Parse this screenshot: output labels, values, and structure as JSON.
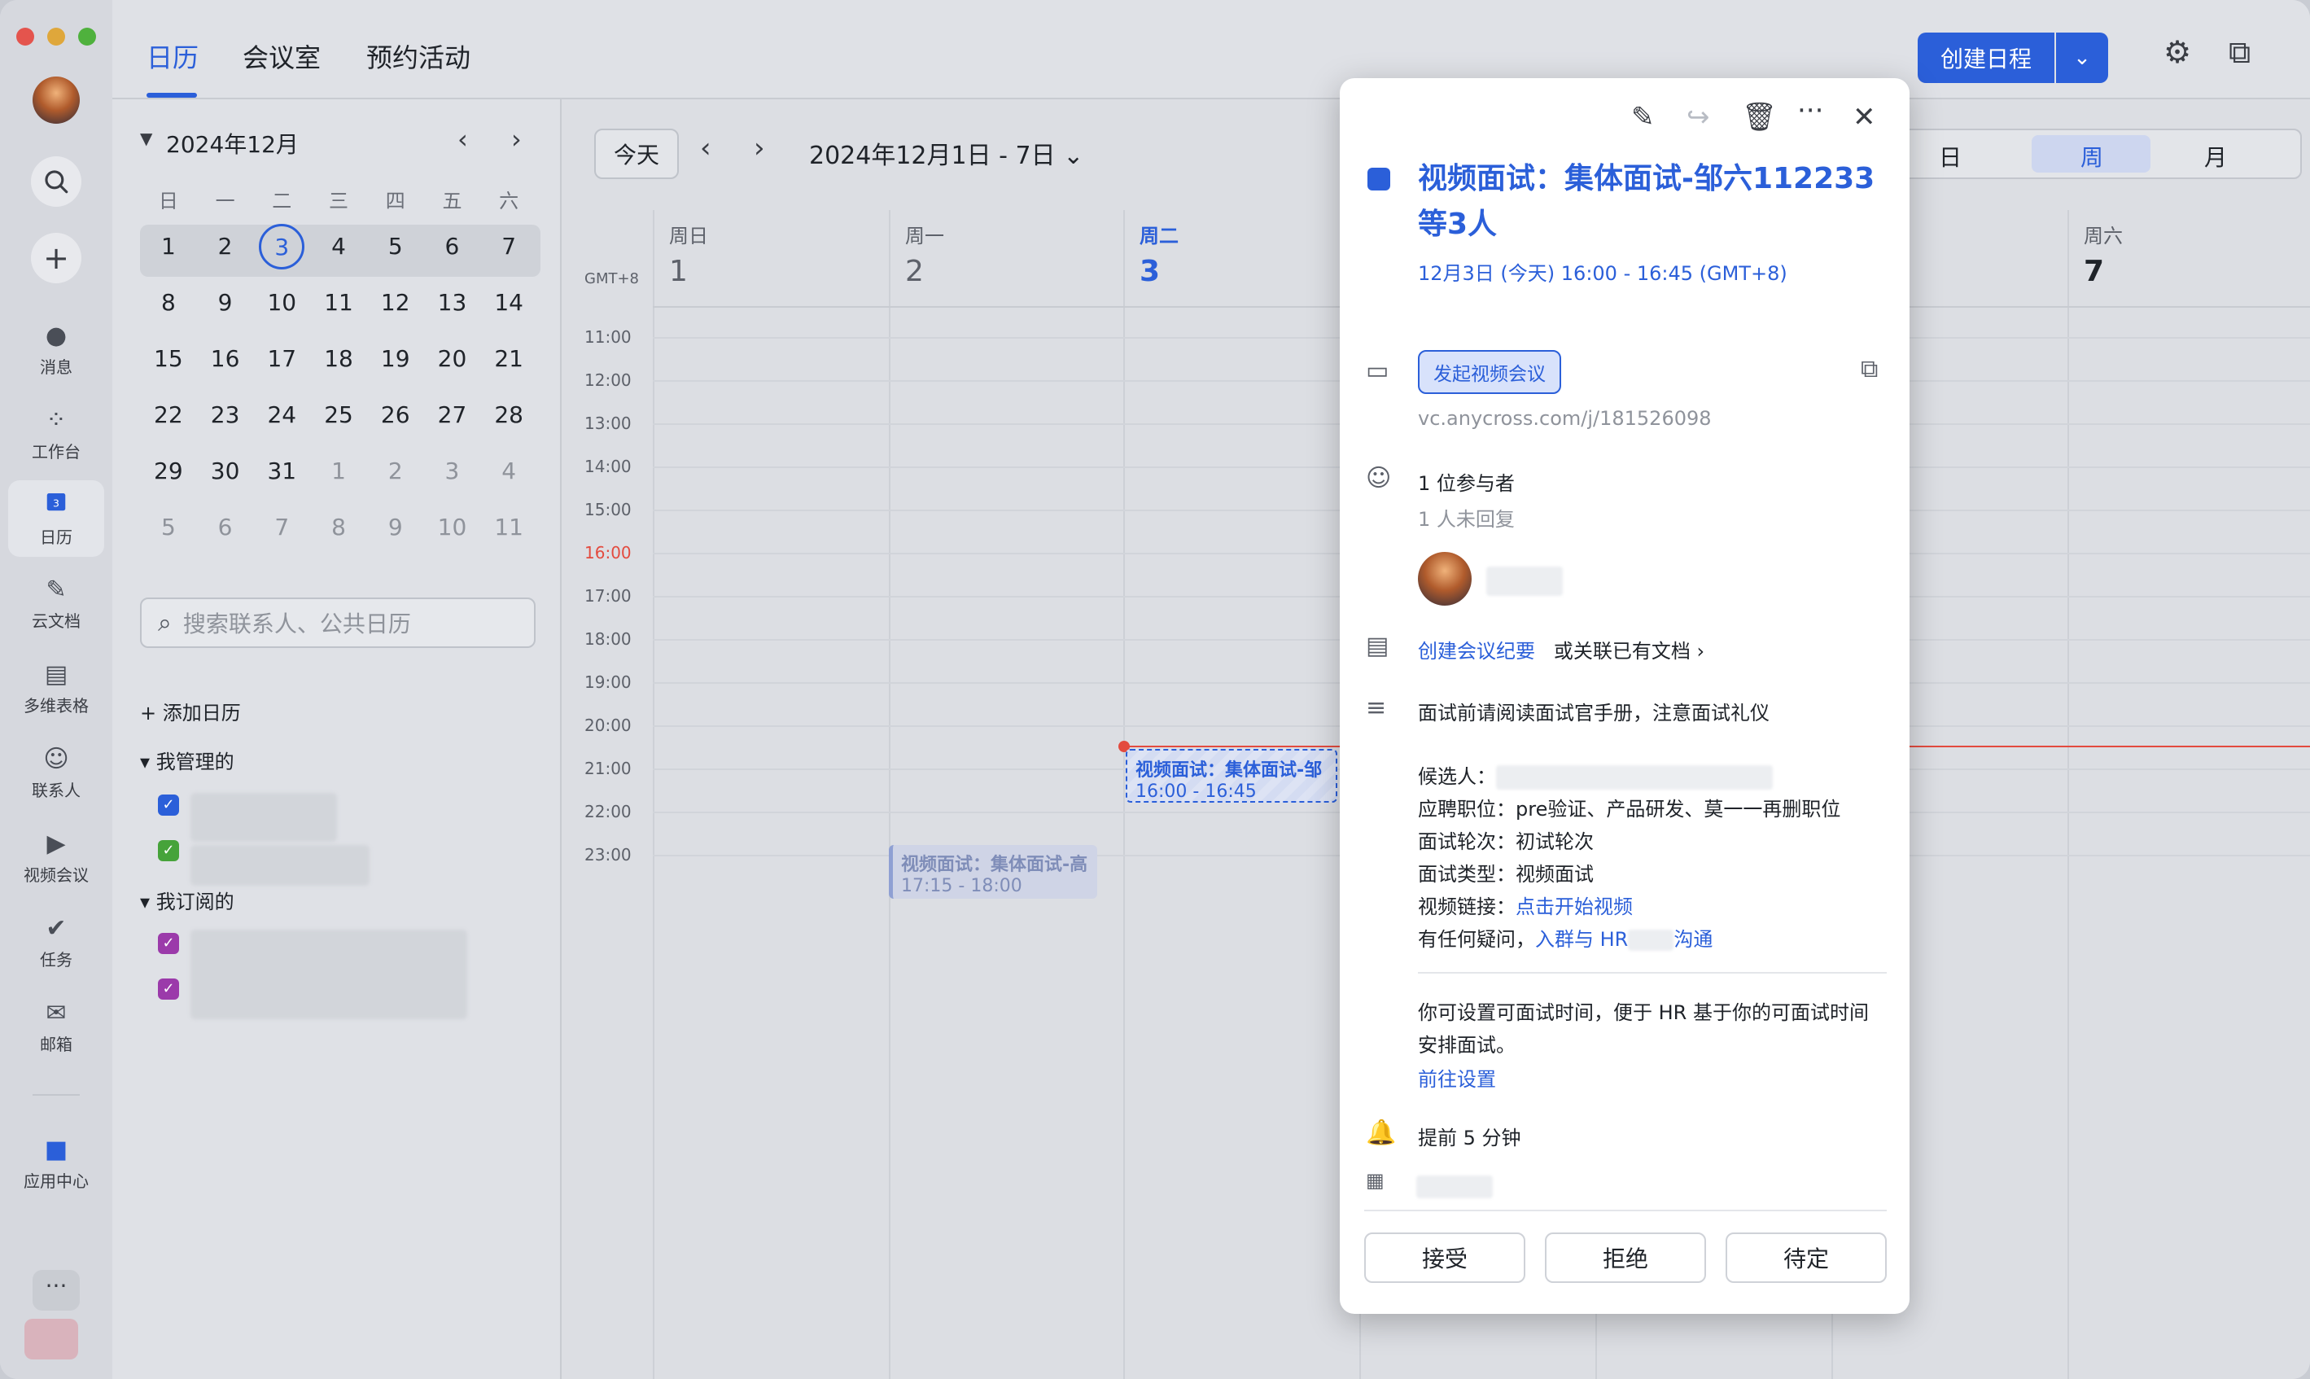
{
  "rail": {
    "items": [
      {
        "label": "消息",
        "icon": "chat-bubble-icon"
      },
      {
        "label": "工作台",
        "icon": "grid-icon"
      },
      {
        "label": "日历",
        "icon": "calendar-icon",
        "badge": "3"
      },
      {
        "label": "云文档",
        "icon": "document-icon"
      },
      {
        "label": "多维表格",
        "icon": "table-icon"
      },
      {
        "label": "联系人",
        "icon": "contacts-icon"
      },
      {
        "label": "视频会议",
        "icon": "video-camera-icon"
      },
      {
        "label": "任务",
        "icon": "check-icon"
      },
      {
        "label": "邮箱",
        "icon": "mail-icon"
      },
      {
        "label": "应用中心",
        "icon": "app-store-icon"
      }
    ],
    "more_label": "···"
  },
  "topbar": {
    "tabs": [
      "日历",
      "会议室",
      "预约活动"
    ],
    "create_label": "创建日程"
  },
  "mini_calendar": {
    "title": "2024年12月",
    "weekdays": [
      "日",
      "一",
      "二",
      "三",
      "四",
      "五",
      "六"
    ],
    "weeks": [
      [
        "1",
        "2",
        "3",
        "4",
        "5",
        "6",
        "7"
      ],
      [
        "8",
        "9",
        "10",
        "11",
        "12",
        "13",
        "14"
      ],
      [
        "15",
        "16",
        "17",
        "18",
        "19",
        "20",
        "21"
      ],
      [
        "22",
        "23",
        "24",
        "25",
        "26",
        "27",
        "28"
      ],
      [
        "29",
        "30",
        "31",
        "1",
        "2",
        "3",
        "4"
      ],
      [
        "5",
        "6",
        "7",
        "8",
        "9",
        "10",
        "11"
      ]
    ],
    "today": "3"
  },
  "sidebar": {
    "search_placeholder": "搜索联系人、公共日历",
    "add_calendar": "添加日历",
    "managed_label": "我管理的",
    "subscribed_label": "我订阅的"
  },
  "toolbar": {
    "today_label": "今天",
    "range_label": "2024年12月1日 - 7日",
    "views": [
      "日",
      "周",
      "月"
    ],
    "active_view": "周"
  },
  "week": {
    "gmt_label": "GMT+8",
    "days": [
      {
        "wd": "周日",
        "num": "1"
      },
      {
        "wd": "周一",
        "num": "2"
      },
      {
        "wd": "周二",
        "num": "3"
      },
      {
        "wd": "周六",
        "num": "7"
      }
    ],
    "hours": [
      "11:00",
      "12:00",
      "13:00",
      "14:00",
      "15:00",
      "16:00",
      "17:00",
      "18:00",
      "19:00",
      "20:00",
      "21:00",
      "22:00",
      "23:00"
    ],
    "events": [
      {
        "title": "视频面试：集体面试-邹",
        "time": "16:00 - 16:45"
      },
      {
        "title": "视频面试：集体面试-高",
        "time": "17:15 - 18:00"
      }
    ]
  },
  "detail": {
    "title": "视频面试：集体面试-邹六112233等3人",
    "time": "12月3日 (今天) 16:00 - 16:45 (GMT+8)",
    "start_video_label": "发起视频会议",
    "video_link": "vc.anycross.com/j/181526098",
    "attendees_count": "1 位参与者",
    "attendees_pending": "1 人未回复",
    "create_minutes": "创建会议纪要",
    "link_doc": "或关联已有文档",
    "note": "面试前请阅读面试官手册，注意面试礼仪",
    "candidate_label": "候选人：",
    "position_label": "应聘职位：",
    "position_value": "pre验证、产品研发、莫一一再删职位",
    "round_label": "面试轮次：",
    "round_value": "初试轮次",
    "type_label": "面试类型：",
    "type_value": "视频面试",
    "video_label": "视频链接：",
    "video_value": "点击开始视频",
    "question_label": "有任何疑问，",
    "question_link_a": "入群与 HR",
    "question_link_b": "沟通",
    "settings_hint": "你可设置可面试时间，便于 HR 基于你的可面试时间安排面试。",
    "goto_settings": "前往设置",
    "reminder": "提前 5 分钟",
    "accept": "接受",
    "decline": "拒绝",
    "tentative": "待定"
  }
}
